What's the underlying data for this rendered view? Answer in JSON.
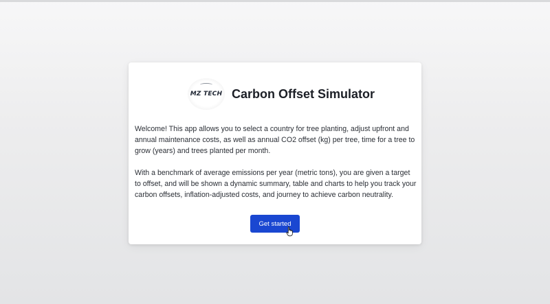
{
  "logo": {
    "text": "MZ TECH"
  },
  "title": "Carbon Offset Simulator",
  "intro": {
    "paragraph1": "Welcome! This app allows you to select a country for tree planting, adjust upfront and annual maintenance costs, as well as annual CO2 offset (kg) per tree, time for a tree to grow (years) and trees planted per month.",
    "paragraph2": "With a benchmark of average emissions per year (metric tons), you are given a target to offset, and will be shown a dynamic summary, table and charts to help you track your carbon offsets, inflation-adjusted costs, and journey to achieve carbon neutrality."
  },
  "button": {
    "label": "Get started"
  },
  "colors": {
    "accent": "#1a47d1",
    "card": "#ffffff",
    "text": "#2b2f36"
  },
  "icons": {
    "cursor": "hand-pointer-icon"
  }
}
